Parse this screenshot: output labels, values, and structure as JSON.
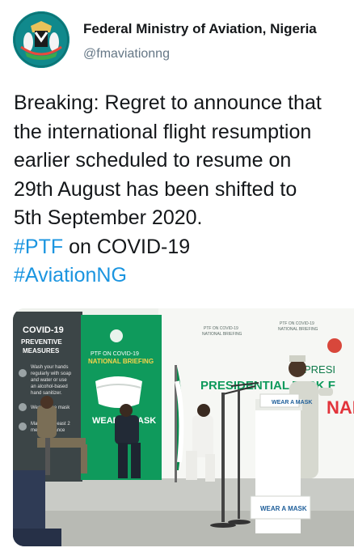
{
  "account": {
    "name": "Federal Ministry of Aviation, Nigeria",
    "handle": "@fmaviationng",
    "avatar_icon": "coat-of-arms-icon"
  },
  "tweet": {
    "line1": "Breaking: Regret to announce that",
    "line2": "the international flight resumption",
    "line3": "earlier scheduled to resume on",
    "line4": "29th August has been shifted to",
    "line5": "5th September 2020.",
    "hashtag_ptf": "#PTF",
    "ptf_suffix": " on COVID-19",
    "hashtag_aviation": "#AviationNG"
  },
  "media": {
    "banner_left_title": "COVID-19",
    "banner_left_subtitle1": "PREVENTIVE",
    "banner_left_subtitle2": "MEASURES",
    "banner_left_item1": "Wash your hands",
    "banner_left_item1b": "regularly with soap",
    "banner_left_item1c": "and water or use",
    "banner_left_item1d": "an alcohol-based",
    "banner_left_item1e": "hand sanitizer.",
    "banner_left_item2": "Wear a face mask",
    "banner_left_item3": "Maintain at least 2",
    "banner_left_item3b": "metres distance",
    "banner_center_line1": "PTF ON COVID-19",
    "banner_center_line2": "NATIONAL BRIEFING",
    "banner_center_wear": "WEAR A MASK",
    "backdrop_line1": "PTF ON COVID-19",
    "backdrop_line2": "NATIONAL BRIEFING",
    "backdrop_presi": "PRESI",
    "backdrop_big": "PRESIDENTIAL TASK F",
    "backdrop_nal": "NAL E",
    "podium_sign": "WEAR A MASK",
    "podium_sign2": "WEAR A MASK",
    "accent_green": "#0f9a5c",
    "accent_blue": "#1b95e0"
  }
}
